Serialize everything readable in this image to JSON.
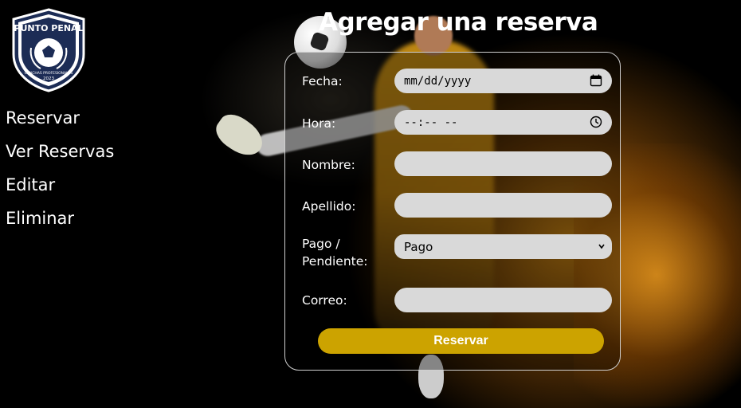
{
  "brand": {
    "logo_text": "PUNTO PENAL",
    "logo_subtext": "CANCHAS PROFESIONALES",
    "logo_year": "2023"
  },
  "sidebar": {
    "items": [
      {
        "label": "Reservar"
      },
      {
        "label": "Ver Reservas"
      },
      {
        "label": "Editar"
      },
      {
        "label": "Eliminar"
      }
    ]
  },
  "page": {
    "title": "Agregar una reserva"
  },
  "form": {
    "fecha": {
      "label": "Fecha:",
      "value": "mm/dd/yyyy"
    },
    "hora": {
      "label": "Hora:",
      "value": "--:-- --"
    },
    "nombre": {
      "label": "Nombre:",
      "value": ""
    },
    "apellido": {
      "label": "Apellido:",
      "value": ""
    },
    "pago": {
      "label_line1": "Pago /",
      "label_line2": "Pendiente:",
      "selected": "Pago"
    },
    "correo": {
      "label": "Correo:",
      "value": ""
    },
    "submit_label": "Reservar"
  },
  "colors": {
    "accent": "#cca300",
    "field_bg": "#d9d9d9",
    "logo_navy": "#1c2c55"
  }
}
